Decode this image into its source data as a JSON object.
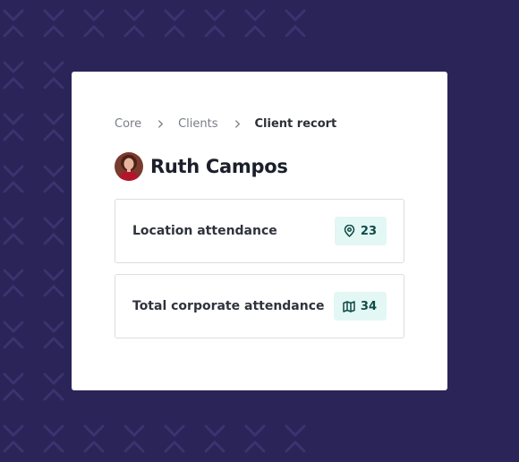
{
  "breadcrumb": {
    "items": [
      "Core",
      "Clients"
    ],
    "current": "Client recort"
  },
  "client": {
    "name": "Ruth Campos"
  },
  "stats": [
    {
      "label": "Location attendance",
      "icon": "map-pin-icon",
      "value": "23"
    },
    {
      "label": "Total corporate attendance",
      "icon": "map-icon",
      "value": "34"
    }
  ],
  "colors": {
    "background": "#2a2458",
    "card": "#ffffff",
    "badge_bg": "#e3f7f4",
    "badge_text": "#0e4a47"
  }
}
